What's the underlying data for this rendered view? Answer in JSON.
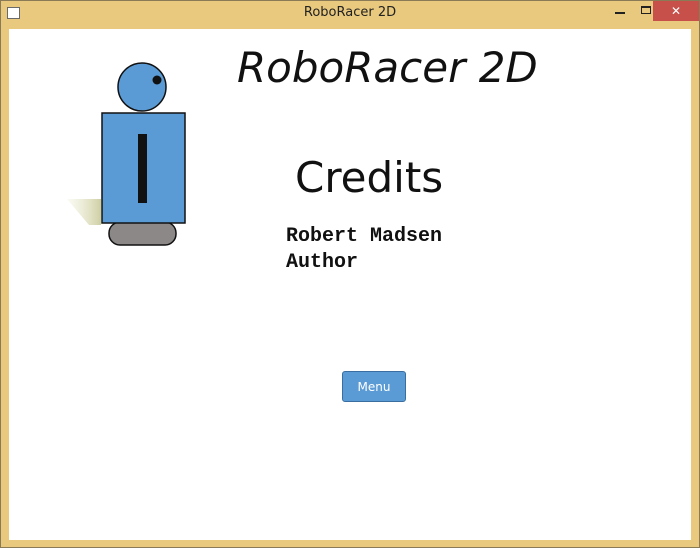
{
  "window": {
    "title": "RoboRacer 2D"
  },
  "screen": {
    "game_title": "RoboRacer 2D",
    "heading": "Credits",
    "credits": [
      {
        "name": "Robert Madsen",
        "role": "Author"
      }
    ],
    "menu_button_label": "Menu"
  },
  "colors": {
    "window_frame": "#e9c97e",
    "close_button": "#c7504a",
    "robot_body": "#5b9bd5",
    "robot_wheel": "#8c8888",
    "button": "#5b9bd5"
  },
  "icons": {
    "app": "app-window-icon",
    "minimize": "minimize-icon",
    "maximize": "maximize-icon",
    "close": "close-icon"
  }
}
